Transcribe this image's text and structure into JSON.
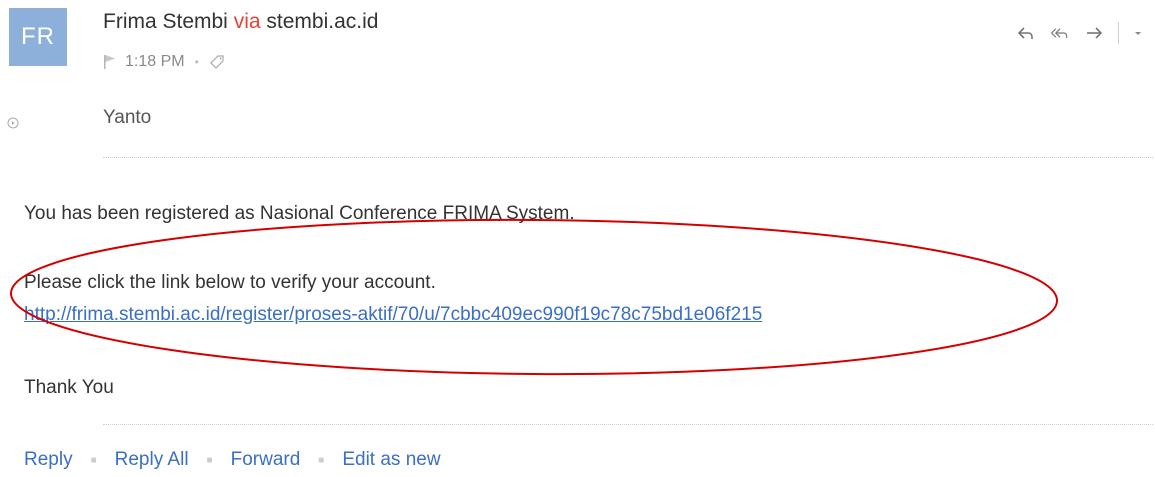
{
  "sender": {
    "initials": "FR",
    "name": "Frima Stembi",
    "via": "via",
    "domain": "stembi.ac.id",
    "time": "1:18 PM"
  },
  "recipient": "Yanto",
  "message": {
    "line1": "You has been registered as Nasional Conference FRIMA System.",
    "line2": "Please click the link below to verify your account.",
    "link": "http://frima.stembi.ac.id/register/proses-aktif/70/u/7cbbc409ec990f19c78c75bd1e06f215",
    "closing": "Thank You"
  },
  "actions": {
    "reply": "Reply",
    "reply_all": "Reply All",
    "forward": "Forward",
    "edit_as_new": "Edit as new"
  },
  "icons": {
    "reply": "reply-icon",
    "reply_all": "reply-all-icon",
    "forward": "forward-icon",
    "more": "chevron-down-icon",
    "flag": "flag-icon",
    "tag": "tag-icon",
    "recipient_toggle": "expand-toggle-icon"
  },
  "colors": {
    "avatar": "#8cb0d9",
    "via": "#e0443a",
    "link": "#3a6fc4",
    "annotation": "#d40000"
  }
}
